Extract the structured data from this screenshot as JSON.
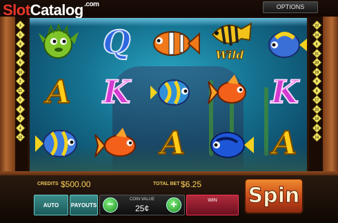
{
  "header": {
    "logo_slot": "Slot",
    "logo_catalog": "Catalog",
    "logo_com": ".com",
    "options_label": "OPTIONS"
  },
  "paylines": {
    "left": [
      "3",
      "5",
      "4",
      "1",
      "9",
      "10",
      "2",
      "11",
      "5",
      "3",
      "2",
      "4",
      "12"
    ],
    "right": [
      "22",
      "24",
      "6",
      "21",
      "20",
      "19",
      "9",
      "8",
      "17",
      "23",
      "18",
      "13",
      "14"
    ]
  },
  "reels": {
    "symbols": [
      {
        "col": 0,
        "row": 0,
        "kind": "fish",
        "name": "green-pufferfish"
      },
      {
        "col": 1,
        "row": 0,
        "kind": "letter",
        "value": "Q"
      },
      {
        "col": 2,
        "row": 0,
        "kind": "fish",
        "name": "clownfish"
      },
      {
        "col": 3,
        "row": 0,
        "kind": "wild",
        "value": "Wild"
      },
      {
        "col": 4,
        "row": 0,
        "kind": "fish",
        "name": "angelfish"
      },
      {
        "col": 0,
        "row": 1,
        "kind": "letter",
        "value": "A"
      },
      {
        "col": 1,
        "row": 1,
        "kind": "letter",
        "value": "K"
      },
      {
        "col": 2,
        "row": 1,
        "kind": "fish",
        "name": "angelfish"
      },
      {
        "col": 3,
        "row": 1,
        "kind": "fish",
        "name": "goldfish"
      },
      {
        "col": 4,
        "row": 1,
        "kind": "letter",
        "value": "K"
      },
      {
        "col": 0,
        "row": 2,
        "kind": "fish",
        "name": "angelfish"
      },
      {
        "col": 1,
        "row": 2,
        "kind": "fish",
        "name": "goldfish"
      },
      {
        "col": 2,
        "row": 2,
        "kind": "letter",
        "value": "A"
      },
      {
        "col": 3,
        "row": 2,
        "kind": "fish",
        "name": "blue-tang"
      },
      {
        "col": 4,
        "row": 2,
        "kind": "letter",
        "value": "A"
      }
    ]
  },
  "controls": {
    "credits_label": "CREDITS",
    "credits_value": "$500.00",
    "total_bet_label": "TOTAL BET",
    "total_bet_value": "$6.25",
    "auto_label": "AUTO",
    "payouts_label": "PAYOUTS",
    "coin_value_label": "COIN VALUE",
    "coin_value": "25¢",
    "minus_label": "−",
    "plus_label": "+",
    "win_label": "WIN",
    "spin_label": "Spin"
  },
  "colors": {
    "accent_gold": "#ffd55a",
    "spin_orange": "#e0712a",
    "water": "#1c8fb0"
  }
}
